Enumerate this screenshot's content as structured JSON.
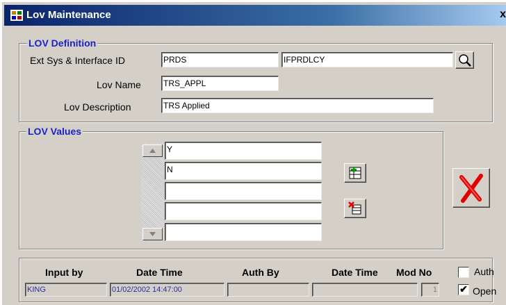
{
  "window": {
    "title": "Lov Maintenance",
    "close_glyph": "x"
  },
  "lov_definition": {
    "title": "LOV Definition",
    "ext_sys_label": "Ext Sys & Interface ID",
    "ext_sys_value": "PRDS",
    "interface_id_value": "IFPRDLCY",
    "lov_name_label": "Lov Name",
    "lov_name_value": "TRS_APPL",
    "lov_desc_label": "Lov Description",
    "lov_desc_value": "TRS Applied"
  },
  "lov_values": {
    "title": "LOV Values",
    "items": [
      "Y",
      "N",
      "",
      "",
      ""
    ]
  },
  "audit": {
    "headers": {
      "input_by": "Input by",
      "date_time": "Date Time",
      "auth_by": "Auth By",
      "date_time_2": "Date Time",
      "mod_no": "Mod No"
    },
    "input_by": "KING",
    "input_date_time": "01/02/2002 14:47:00",
    "auth_by": "",
    "auth_date_time": "",
    "mod_no": "1",
    "auth_label": "Auth",
    "auth_checked": false,
    "open_label": "Open",
    "open_checked": true
  },
  "icons": {
    "app": "app-icon",
    "lookup": "magnifier-icon",
    "add_row": "add-row-icon",
    "delete_row": "delete-row-icon",
    "exit": "red-x-icon"
  },
  "colors": {
    "group_title": "#1a22c8",
    "title_bar": "#0a246a",
    "exit_x": "#e00000"
  }
}
